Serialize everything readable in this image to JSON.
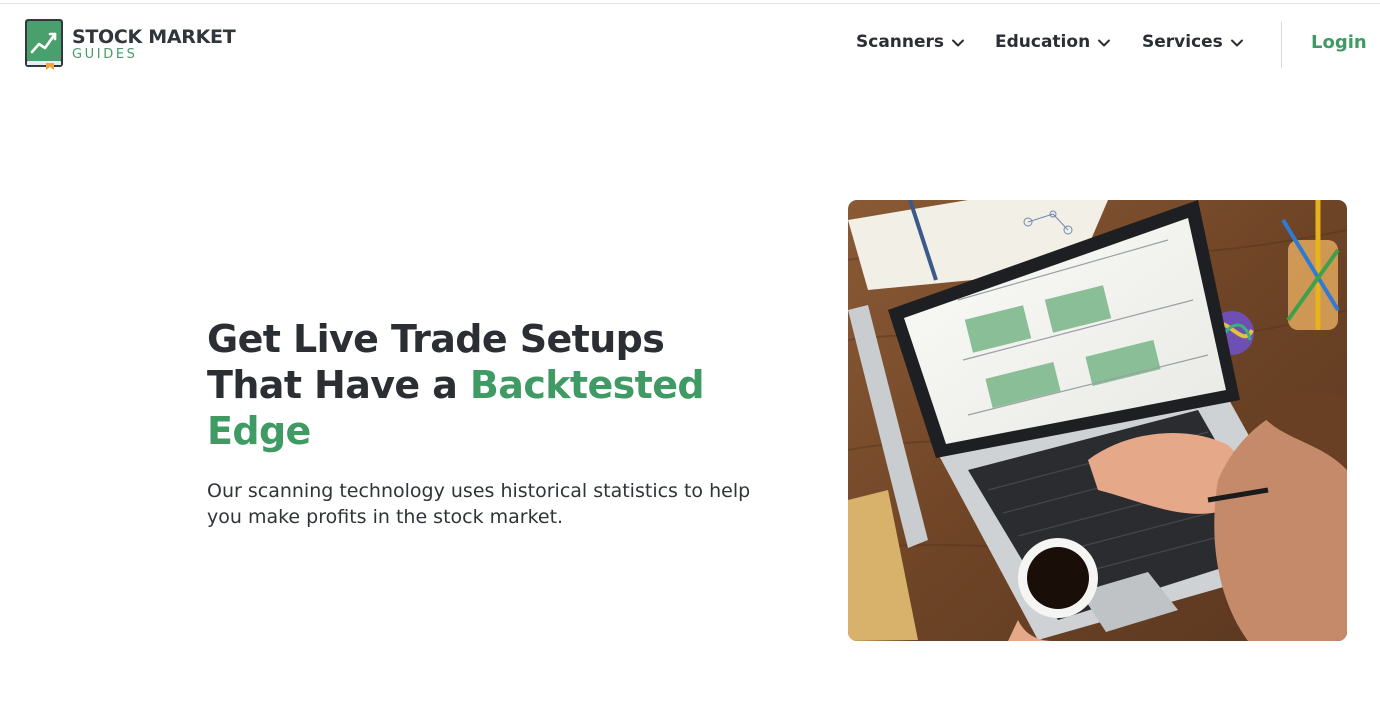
{
  "brand": {
    "line1": "STOCK MARKET",
    "line2": "GUIDES",
    "logo_icon": "chart-book-icon",
    "accent_color": "#3f9a63"
  },
  "nav": {
    "items": [
      {
        "label": "Scanners",
        "icon": "chevron-down-icon"
      },
      {
        "label": "Education",
        "icon": "chevron-down-icon"
      },
      {
        "label": "Services",
        "icon": "chevron-down-icon"
      }
    ],
    "login_label": "Login"
  },
  "hero": {
    "title_part1": "Get Live Trade Setups That Have a ",
    "title_accent": "Backtested Edge",
    "subtitle": "Our scanning technology uses historical statistics to help you make profits in the stock market.",
    "image_subject": "laptop-on-wooden-desk-photo"
  },
  "colors": {
    "text_dark": "#2b2f33",
    "accent_green": "#3f9a63"
  }
}
